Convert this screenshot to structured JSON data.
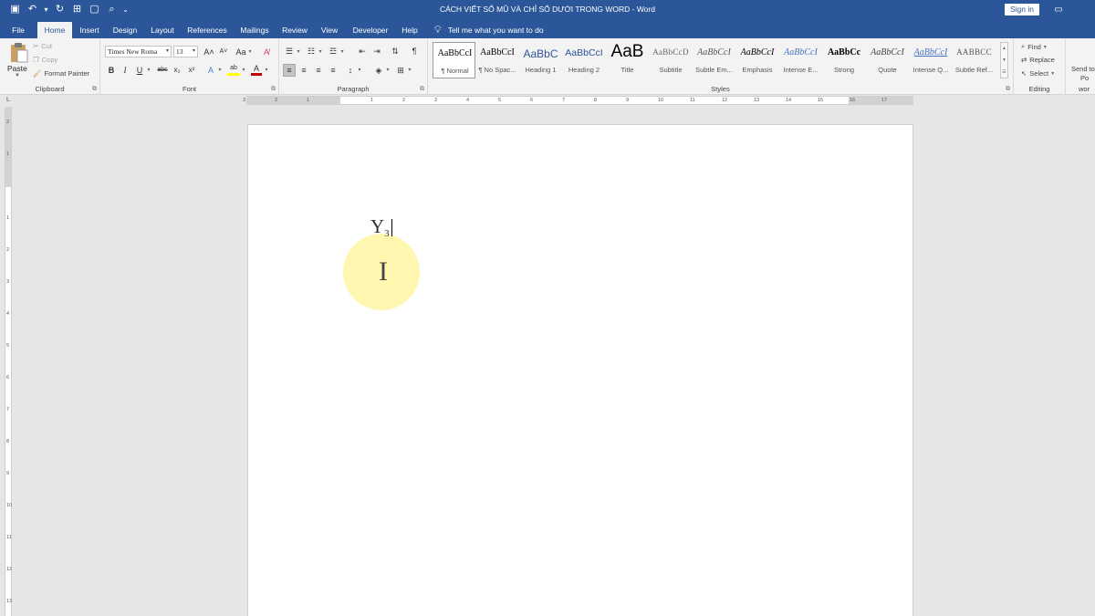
{
  "title_bar": {
    "document_title": "CÁCH VIẾT SỐ MŨ VÀ CHỈ SỐ DƯỚI TRONG WORD  -  Word",
    "sign_in_label": "Sign in",
    "qat": [
      {
        "icon": "save-icon",
        "glyph": "▣"
      },
      {
        "icon": "undo-icon",
        "glyph": "↶"
      },
      {
        "icon": "undo-dropdown-icon",
        "glyph": "▾"
      },
      {
        "icon": "redo-icon",
        "glyph": "↻"
      },
      {
        "icon": "touch-mode-icon",
        "glyph": "⊞"
      },
      {
        "icon": "new-document-icon",
        "glyph": "▢"
      },
      {
        "icon": "print-preview-icon",
        "glyph": "⌕"
      },
      {
        "icon": "customize-qat-icon",
        "glyph": "⌄"
      }
    ],
    "ribbon_display_glyph": "▭"
  },
  "tabs": [
    {
      "label": "File",
      "active": false
    },
    {
      "label": "Home",
      "active": true
    },
    {
      "label": "Insert",
      "active": false
    },
    {
      "label": "Design",
      "active": false
    },
    {
      "label": "Layout",
      "active": false
    },
    {
      "label": "References",
      "active": false
    },
    {
      "label": "Mailings",
      "active": false
    },
    {
      "label": "Review",
      "active": false
    },
    {
      "label": "View",
      "active": false
    },
    {
      "label": "Developer",
      "active": false
    },
    {
      "label": "Help",
      "active": false
    }
  ],
  "tell_me": "Tell me what you want to do",
  "clipboard": {
    "paste_label": "Paste",
    "cut_label": "Cut",
    "copy_label": "Copy",
    "format_painter_label": "Format Painter",
    "group_label": "Clipboard"
  },
  "font": {
    "font_name": "Times New Roma",
    "font_size": "13",
    "grow_label": "A˄",
    "shrink_label": "A˅",
    "case_label": "Aa",
    "bold_label": "B",
    "italic_label": "I",
    "underline_label": "U",
    "strike_label": "abc",
    "subscript_label": "x₂",
    "superscript_label": "x²",
    "text_effects_label": "A",
    "highlight_label": "ab",
    "font_color_label": "A",
    "group_label": "Font"
  },
  "paragraph": {
    "group_label": "Paragraph"
  },
  "styles": {
    "group_label": "Styles",
    "items": [
      {
        "sample": "AaBbCcI",
        "name": "¶ Normal",
        "selected": true
      },
      {
        "sample": "AaBbCcI",
        "name": "¶ No Spac...",
        "selected": false
      },
      {
        "sample": "AaBbC",
        "name": "Heading 1",
        "selected": false
      },
      {
        "sample": "AaBbCcI",
        "name": "Heading 2",
        "selected": false
      },
      {
        "sample": "AaB",
        "name": "Title",
        "selected": false
      },
      {
        "sample": "AaBbCcD",
        "name": "Subtitle",
        "selected": false
      },
      {
        "sample": "AaBbCcI",
        "name": "Subtle Em...",
        "selected": false
      },
      {
        "sample": "AaBbCcI",
        "name": "Emphasis",
        "selected": false
      },
      {
        "sample": "AaBbCcI",
        "name": "Intense E...",
        "selected": false
      },
      {
        "sample": "AaBbCc",
        "name": "Strong",
        "selected": false
      },
      {
        "sample": "AaBbCcI",
        "name": "Quote",
        "selected": false
      },
      {
        "sample": "AaBbCcI",
        "name": "Intense Q...",
        "selected": false
      },
      {
        "sample": "AABBCC",
        "name": "Subtle Ref...",
        "selected": false
      }
    ]
  },
  "editing": {
    "find_label": "Find",
    "replace_label": "Replace",
    "select_label": "Select",
    "group_label": "Editing"
  },
  "send": {
    "label_line1": "Send to",
    "label_line2": "Po",
    "group_label": "wor"
  },
  "ruler": {
    "h_numbers": [
      "3",
      "2",
      "1",
      "1",
      "2",
      "3",
      "4",
      "5",
      "6",
      "7",
      "8",
      "9",
      "10",
      "11",
      "12",
      "13",
      "14",
      "15",
      "16",
      "17"
    ],
    "v_numbers": [
      "2",
      "1",
      "1",
      "2",
      "3",
      "4",
      "5",
      "6",
      "7",
      "8",
      "9",
      "10",
      "11",
      "12",
      "13"
    ],
    "tab_selector": "L"
  },
  "document": {
    "text_main": "Y",
    "text_subscript": "3"
  },
  "colors": {
    "accent": "#2b579a",
    "ribbon": "#f3f3f3",
    "workspace": "#e6e6e6",
    "font_color_bar": "#c00000",
    "highlight_bar": "#ffff00"
  }
}
